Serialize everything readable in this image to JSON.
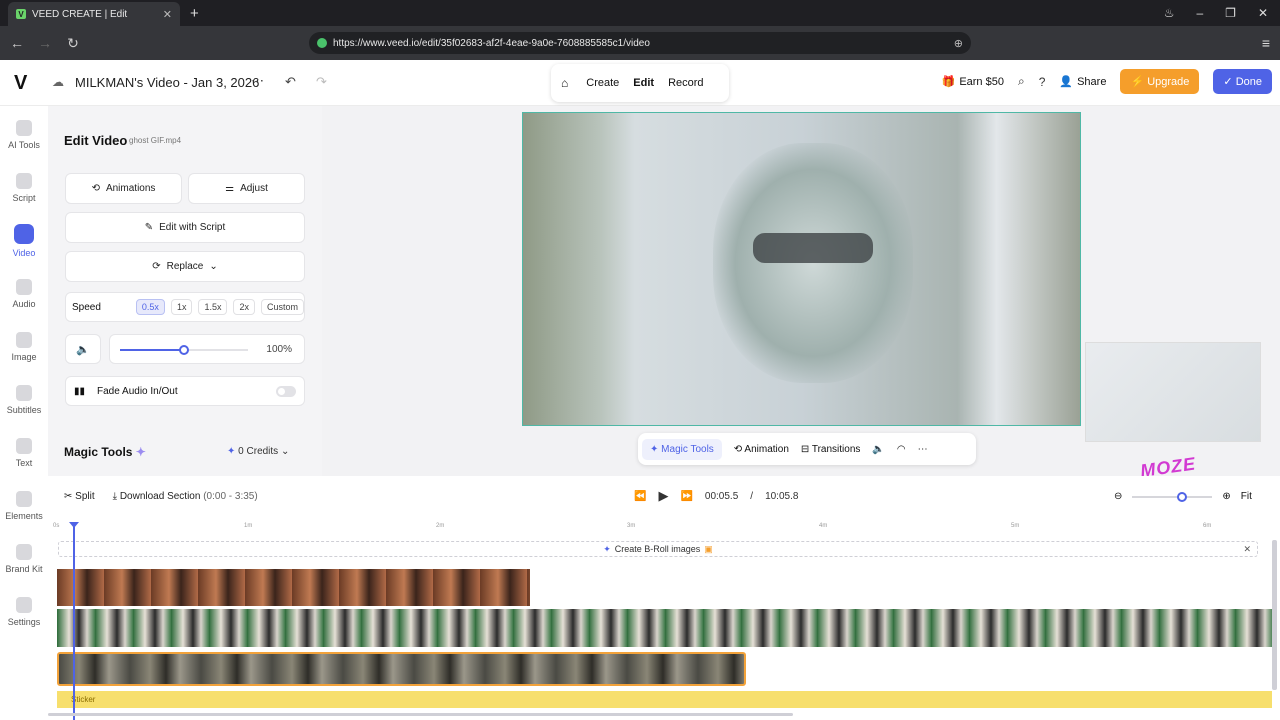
{
  "browser": {
    "tab_title": "VEED CREATE | Edit",
    "url": "https://www.veed.io/edit/35f02683-af2f-4eae-9a0e-7608885585c1/video"
  },
  "header": {
    "logo": "V",
    "project_title": "MILKMAN's Video - Jan 3, 2026",
    "modes": [
      "Create",
      "Edit",
      "Record"
    ],
    "active_mode": "Edit",
    "earn": "Earn $50",
    "share": "Share",
    "upgrade": "Upgrade",
    "done": "Done"
  },
  "rail": [
    {
      "label": "AI Tools"
    },
    {
      "label": "Script"
    },
    {
      "label": "Video"
    },
    {
      "label": "Audio"
    },
    {
      "label": "Image"
    },
    {
      "label": "Subtitles"
    },
    {
      "label": "Text"
    },
    {
      "label": "Elements"
    },
    {
      "label": "Brand Kit"
    },
    {
      "label": "Settings"
    }
  ],
  "panel": {
    "title": "Edit Video",
    "file_name": "ghost GIF.mp4",
    "animations": "Animations",
    "adjust": "Adjust",
    "edit_with_script": "Edit with Script",
    "replace": "Replace",
    "speed_label": "Speed",
    "speeds": [
      "0.5x",
      "1x",
      "1.5x",
      "2x",
      "Custom"
    ],
    "selected_speed": "0.5x",
    "volume_value": "100%",
    "volume_fraction": 1.0,
    "fade_label": "Fade Audio In/Out",
    "magic_title": "Magic Tools",
    "credits": "0 Credits"
  },
  "canvas_toolbar": {
    "magic_tools": "Magic Tools",
    "animation": "Animation",
    "transitions": "Transitions"
  },
  "timeline": {
    "split": "Split",
    "download": "Download Section",
    "download_range": "(0:00 - 3:35)",
    "current_time": "00:05.5",
    "separator": "/",
    "total_time": "10:05.8",
    "fit": "Fit",
    "ruler_labels": [
      "0s",
      "1m",
      "2m",
      "3m",
      "4m",
      "5m",
      "6m"
    ],
    "broll": "Create B-Roll images",
    "sticker_label": "Sticker"
  },
  "colors": {
    "accent": "#4f63e6",
    "upgrade": "#f59e2b",
    "selection_border": "#f2a23a",
    "sticker_track": "#f7df6d"
  }
}
